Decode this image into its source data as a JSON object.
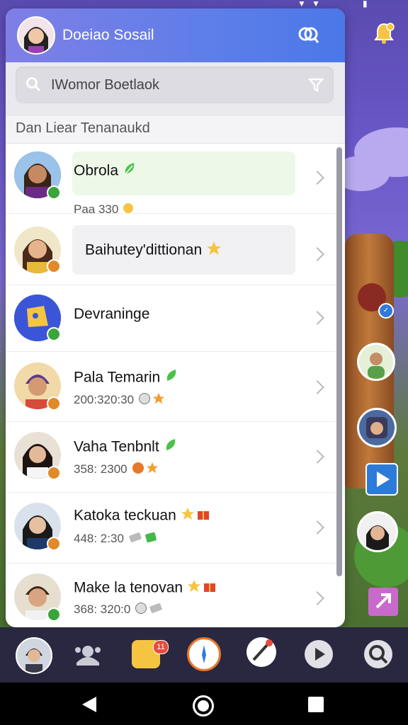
{
  "app": {
    "title": "Doeiao Sosail"
  },
  "search": {
    "value": "IWomor Boetlaok"
  },
  "section": {
    "label": "Dan Liear Tenanaukd"
  },
  "conversations": [
    {
      "name": "Obrola",
      "meta": "Paa 330",
      "status": "online"
    },
    {
      "name": "Baihutey'dittionan",
      "meta": "",
      "status": "away"
    },
    {
      "name": "Devraningе",
      "meta": "",
      "status": "online"
    },
    {
      "name": "Pala Temarin",
      "meta": "200:320:30",
      "status": "away"
    },
    {
      "name": "Vaha Tenbnlt",
      "meta": "358: 2300",
      "status": "away"
    },
    {
      "name": "Katoka teckuan",
      "meta": "448: 2:30",
      "status": "away"
    },
    {
      "name": "Make la tenovan",
      "meta": "368: 320:0",
      "status": "online"
    }
  ],
  "nav": {
    "notification_count": "11"
  },
  "colors": {
    "header_accent": "#5e7ee8",
    "online_badge": "#3aa53a",
    "away_badge": "#e08a2a",
    "nav_background": "#2a2740"
  }
}
